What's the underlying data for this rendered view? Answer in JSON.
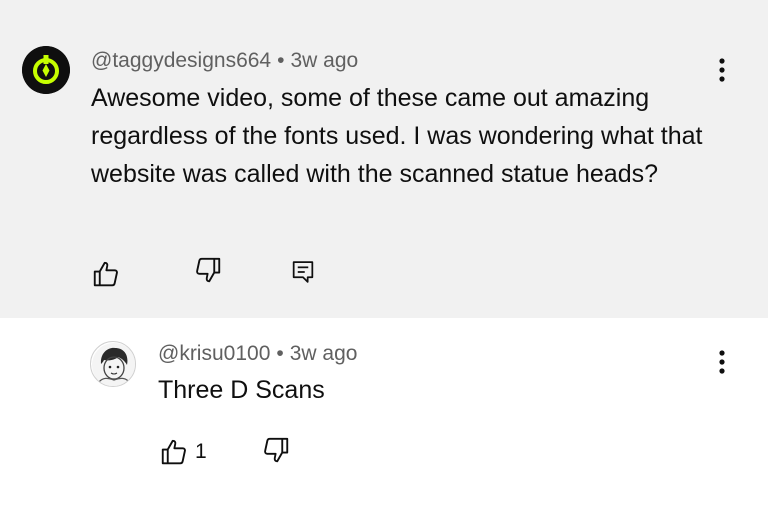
{
  "comment": {
    "author": "@taggydesigns664",
    "separator": "•",
    "time": "3w ago",
    "text": "Awesome video, some of these came out amazing regardless of the fonts used. I was wondering what that website was called with the scanned statue heads?",
    "avatar_colors": {
      "bg": "#0f0f0f",
      "accent": "#c6ff00"
    },
    "icons": {
      "like": "thumbs-up-icon",
      "dislike": "thumbs-down-icon",
      "reply": "reply-icon",
      "menu": "more-vert-icon"
    }
  },
  "reply": {
    "author": "@krisu0100",
    "separator": "•",
    "time": "3w ago",
    "text": "Three D Scans",
    "like_count": "1",
    "icons": {
      "like": "thumbs-up-icon",
      "dislike": "thumbs-down-icon",
      "menu": "more-vert-icon"
    }
  }
}
